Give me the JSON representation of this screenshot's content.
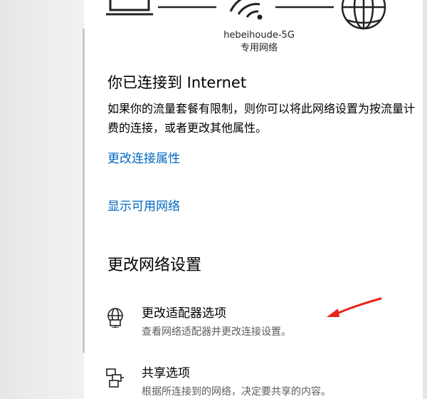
{
  "network": {
    "ssid": "hebeihoude-5G",
    "profile": "专用网络"
  },
  "status": {
    "title": "你已连接到 Internet",
    "description_line1": "如果你的流量套餐有限制，则你可以将此网络设置为按流量计",
    "description_line2": "费的连接，或者更改其他属性。"
  },
  "links": {
    "change_connection_properties": "更改连接属性",
    "show_available_networks": "显示可用网络"
  },
  "change_settings": {
    "title": "更改网络设置",
    "items": [
      {
        "icon": "network-adapter-icon",
        "title": "更改适配器选项",
        "description": "查看网络适配器并更改连接设置。"
      },
      {
        "icon": "sharing-icon",
        "title": "共享选项",
        "description": "根据所连接到的网络，决定要共享的内容。"
      }
    ]
  },
  "colors": {
    "link": "#0067c0",
    "annotation_arrow": "#e8241c",
    "sidebar": "#e6e6e6"
  }
}
